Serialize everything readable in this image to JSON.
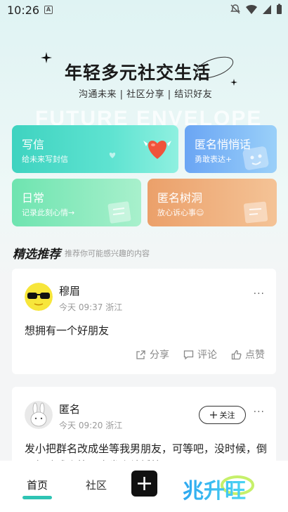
{
  "status_bar": {
    "time": "10:26",
    "badge": "A"
  },
  "hero": {
    "title": "年轻多元社交生活",
    "subtitle": "沟通未来 | 社区分享 | 结识好友",
    "watermark": "FUTURE ENVELOPE"
  },
  "cards": {
    "letter": {
      "title": "写信",
      "subtitle": "给未来写封信"
    },
    "anonymous": {
      "title": "匿名悄悄话",
      "subtitle": "勇敢表达+"
    },
    "daily": {
      "title": "日常",
      "subtitle": "记录此刻心情→"
    },
    "tree_hole": {
      "title": "匿名树洞",
      "subtitle": "放心诉心事☺"
    }
  },
  "section": {
    "title": "精选推荐",
    "subtitle": "推荐你可能感兴趣的内容"
  },
  "posts": [
    {
      "user": "穆眉",
      "meta": "今天 09:37 浙江",
      "content": "想拥有一个好朋友",
      "actions": {
        "share": "分享",
        "comment": "评论",
        "like": "点赞"
      }
    },
    {
      "user": "匿名",
      "meta": "今天 09:20 浙江",
      "follow": "关注",
      "content": "发小把群名改成坐等我男朋友，可等吧，没时候，倒不如改成坐等昂余发小结婚快"
    }
  ],
  "post_more": "···",
  "nav": {
    "home": "首页",
    "community": "社区",
    "logo_text": "兆升旺"
  },
  "colors": {
    "accent": "#2fc4b4",
    "letter_card": "#3ed3c0",
    "anon_card": "#6aa5f4",
    "daily_card": "#6ee4b0",
    "tree_card": "#eba06a"
  }
}
